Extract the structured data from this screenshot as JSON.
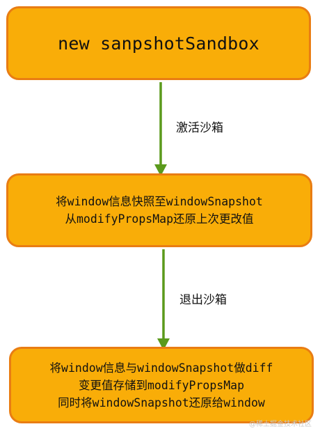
{
  "nodes": {
    "start": {
      "label": "new sanpshotSandbox"
    },
    "activate": {
      "lines": [
        "将window信息快照至windowSnapshot",
        "从modifyPropsMap还原上次更改值"
      ]
    },
    "exit": {
      "lines": [
        "将window信息与windowSnapshot做diff",
        "变更值存储到modifyPropsMap",
        "同时将windowSnapshot还原给window"
      ]
    }
  },
  "edges": {
    "activate": {
      "label": "激活沙箱"
    },
    "exit": {
      "label": "退出沙箱"
    }
  },
  "watermark": "@稀土掘金技术社区",
  "colors": {
    "node_fill": "#f9ad08",
    "node_border": "#e97d13",
    "arrow": "#5b9a1c"
  }
}
